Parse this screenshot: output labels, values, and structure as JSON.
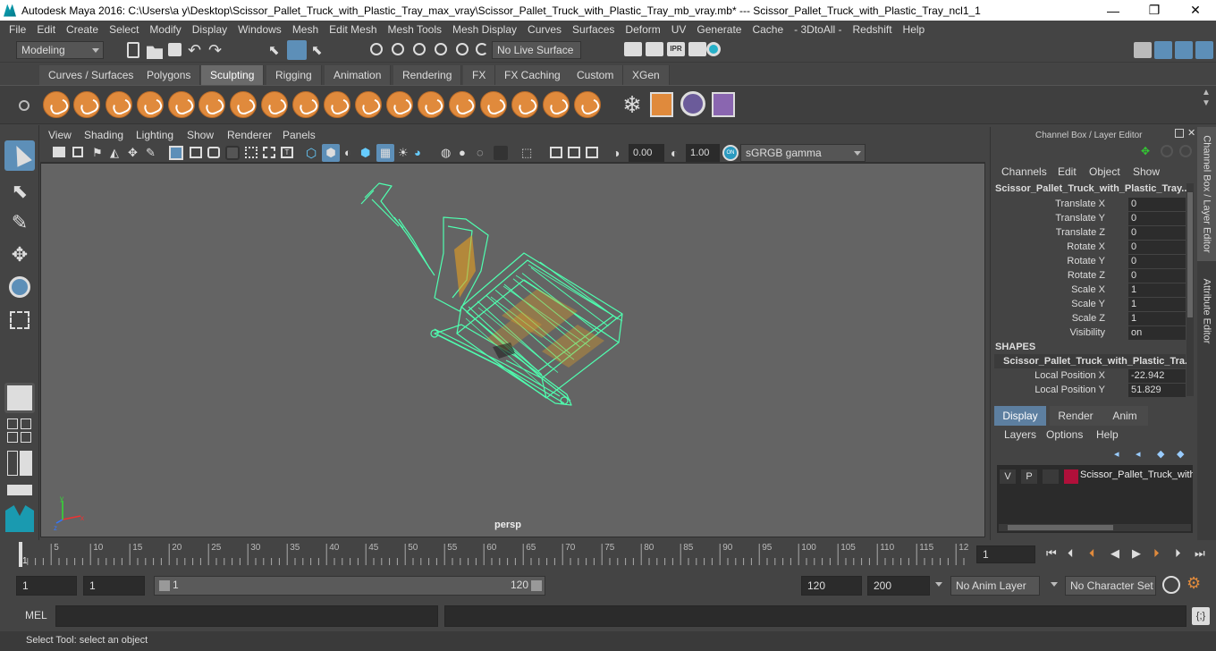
{
  "window": {
    "title": "Autodesk Maya 2016: C:\\Users\\a y\\Desktop\\Scissor_Pallet_Truck_with_Plastic_Tray_max_vray\\Scissor_Pallet_Truck_with_Plastic_Tray_mb_vray.mb*  ---  Scissor_Pallet_Truck_with_Plastic_Tray_ncl1_1",
    "minimize": "—",
    "maximize": "❐",
    "close": "✕"
  },
  "menubar": [
    "File",
    "Edit",
    "Create",
    "Select",
    "Modify",
    "Display",
    "Windows",
    "Mesh",
    "Edit Mesh",
    "Mesh Tools",
    "Mesh Display",
    "Curves",
    "Surfaces",
    "Deform",
    "UV",
    "Generate",
    "Cache",
    "- 3DtoAll -",
    "Redshift",
    "Help"
  ],
  "statusline": {
    "menuset": "Modeling",
    "live_surface": "No Live Surface"
  },
  "shelf_tabs": [
    "Curves / Surfaces",
    "Polygons",
    "Sculpting",
    "Rigging",
    "Animation",
    "Rendering",
    "FX",
    "FX Caching",
    "Custom",
    "XGen"
  ],
  "active_shelf_tab": "Sculpting",
  "viewport": {
    "menus": [
      "View",
      "Shading",
      "Lighting",
      "Show",
      "Renderer",
      "Panels"
    ],
    "exposure": "0.00",
    "gamma": "1.00",
    "colorspace": "sGRGB gamma",
    "camera_label": "persp",
    "wire_color": "#4fffb0",
    "background": "#646464"
  },
  "channel_box": {
    "header": "Channel Box / Layer Editor",
    "menus": [
      "Channels",
      "Edit",
      "Object",
      "Show"
    ],
    "object_name": "Scissor_Pallet_Truck_with_Plastic_Tray...",
    "channels": [
      {
        "label": "Translate X",
        "value": "0"
      },
      {
        "label": "Translate Y",
        "value": "0"
      },
      {
        "label": "Translate Z",
        "value": "0"
      },
      {
        "label": "Rotate X",
        "value": "0"
      },
      {
        "label": "Rotate Y",
        "value": "0"
      },
      {
        "label": "Rotate Z",
        "value": "0"
      },
      {
        "label": "Scale X",
        "value": "1"
      },
      {
        "label": "Scale Y",
        "value": "1"
      },
      {
        "label": "Scale Z",
        "value": "1"
      },
      {
        "label": "Visibility",
        "value": "on"
      }
    ],
    "shapes_header": "SHAPES",
    "shape_name": "Scissor_Pallet_Truck_with_Plastic_Tra...",
    "shape_channels": [
      {
        "label": "Local Position X",
        "value": "-22.942"
      },
      {
        "label": "Local Position Y",
        "value": "51.829"
      }
    ]
  },
  "layer_editor": {
    "tabs": [
      "Display",
      "Render",
      "Anim"
    ],
    "active_tab": "Display",
    "menus": [
      "Layers",
      "Options",
      "Help"
    ],
    "layer": {
      "v": "V",
      "p": "P",
      "name": "Scissor_Pallet_Truck_with",
      "color": "#b0103a"
    }
  },
  "side_tabs": [
    "Channel Box / Layer Editor",
    "Attribute Editor"
  ],
  "timeline": {
    "ticks": [
      "5",
      "10",
      "15",
      "20",
      "25",
      "30",
      "35",
      "40",
      "45",
      "50",
      "55",
      "60",
      "65",
      "70",
      "75",
      "80",
      "85",
      "90",
      "95",
      "100",
      "105",
      "110",
      "115",
      "12"
    ],
    "start_marker": "1",
    "current_frame": "1"
  },
  "range": {
    "start": "1",
    "playback_start": "1",
    "slider_start": "1",
    "slider_end": "120",
    "playback_end": "120",
    "end": "200",
    "anim_layer": "No Anim Layer",
    "character_set": "No Character Set"
  },
  "cmdline": {
    "label": "MEL"
  },
  "helpline": {
    "text": "Select Tool: select an object"
  }
}
